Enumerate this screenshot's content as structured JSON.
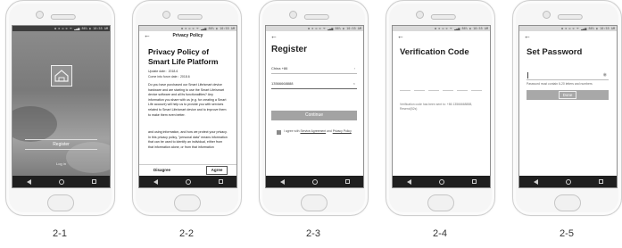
{
  "phones": [
    {
      "caption": "2-1",
      "register_label": "Register",
      "login_label": "Log in"
    },
    {
      "caption": "2-2",
      "header_title": "Privacy Policy",
      "heading": "Privacy Policy of Smart Life Platform",
      "update_date": "Update date：2018.6",
      "effective_date": "Come into force date：2018.6",
      "body_paragraphs": [
        "Do you have purchased our Smart Life/smart device hardware and are starting to use the Smart Life/smart device software and all its functionalities? Any information you share with us (e.g. for creating a Smart Life account) will help us to provide you with services related to Smart Life/smart device and to improve them to make them even better.",
        "and using information, and how we protect your privacy. In this privacy policy, \"personal data\" means information that can be used to identify an individual, either from that information alone, or from that information"
      ],
      "disagree_label": "Disagree",
      "agree_label": "Agree"
    },
    {
      "caption": "2-3",
      "heading": "Register",
      "country_value": "China +86",
      "phone_value": "13566668888",
      "continue_label": "Continue",
      "terms_prefix": "I agree with ",
      "terms_link1": "Service Agreement",
      "terms_mid": " and ",
      "terms_link2": "Privacy Policy"
    },
    {
      "caption": "2-4",
      "heading": "Verification Code",
      "message": "Verification code has been sent to: +86 13566668888, Resend(52s)"
    },
    {
      "caption": "2-5",
      "heading": "Set Password",
      "hint": "Password must contain 6-20 letters and numbers",
      "done_label": "Done"
    }
  ],
  "status_text": "✱ ⊙ ✉ ⊙ ᯤ ▂▃▅ 86% ▮ 10:55 AM"
}
